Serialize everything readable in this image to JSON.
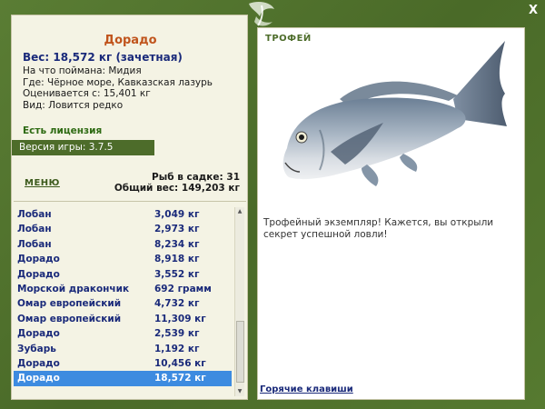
{
  "window": {
    "close_label": "X"
  },
  "fish": {
    "name": "Дорадо",
    "weight_line": "Вес: 18,572 кг (зачетная)",
    "bait": "На что поймана: Мидия",
    "location": "Где: Чёрное море, Кавказская лазурь",
    "value": "Оценивается с: 15,401 кг",
    "rarity": "Вид: Ловится редко"
  },
  "license": "Есть лицензия",
  "version": "Версия игры: 3.7.5",
  "menu_label": "МЕНЮ",
  "stats": {
    "fish_in_cage": "Рыб в садке: 31",
    "total_weight": "Общий вес: 149,203 кг"
  },
  "catch_list": [
    {
      "name": "Лобан",
      "weight": "3,049 кг"
    },
    {
      "name": "Лобан",
      "weight": "2,973 кг"
    },
    {
      "name": "Лобан",
      "weight": "8,234 кг"
    },
    {
      "name": "Дорадо",
      "weight": "8,918 кг"
    },
    {
      "name": "Дорадо",
      "weight": "3,552 кг"
    },
    {
      "name": "Морской дракончик",
      "weight": "692 грамм"
    },
    {
      "name": "Омар европейский",
      "weight": "4,732 кг"
    },
    {
      "name": "Омар европейский",
      "weight": "11,309 кг"
    },
    {
      "name": "Дорадо",
      "weight": "2,539 кг"
    },
    {
      "name": "Зубарь",
      "weight": "1,192 кг"
    },
    {
      "name": "Дорадо",
      "weight": "10,456 кг"
    },
    {
      "name": "Дорадо",
      "weight": "18,572 кг"
    }
  ],
  "trophy": {
    "title": "ТРОФЕЙ",
    "text": "Трофейный экземпляр! Кажется, вы открыли секрет успешной ловли!"
  },
  "hotkeys_label": "Горячие клавиши",
  "colors": {
    "frame": "#4a6b2c",
    "panel": "#f4f3e4",
    "selection": "#3d8be0",
    "fish_name": "#c0541c",
    "list_text": "#1a2a7a"
  }
}
